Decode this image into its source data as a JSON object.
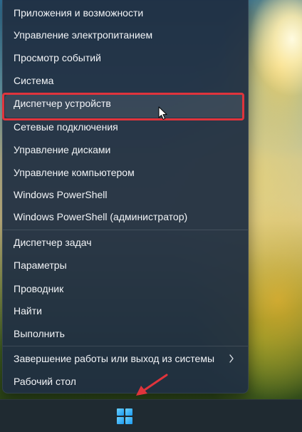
{
  "menu": {
    "items": [
      {
        "label": "Приложения и возможности"
      },
      {
        "label": "Управление электропитанием"
      },
      {
        "label": "Просмотр событий"
      },
      {
        "label": "Система"
      },
      {
        "label": "Диспетчер устройств"
      },
      {
        "label": "Сетевые подключения"
      },
      {
        "label": "Управление дисками"
      },
      {
        "label": "Управление компьютером"
      },
      {
        "label": "Windows PowerShell"
      },
      {
        "label": "Windows PowerShell (администратор)"
      },
      {
        "label": "Диспетчер задач"
      },
      {
        "label": "Параметры"
      },
      {
        "label": "Проводник"
      },
      {
        "label": "Найти"
      },
      {
        "label": "Выполнить"
      },
      {
        "label": "Завершение работы или выход из системы"
      },
      {
        "label": "Рабочий стол"
      }
    ],
    "highlighted_item": "Диспетчер устройств"
  },
  "colors": {
    "highlight_box": "#e0343c",
    "annotation_arrow": "#e0343c",
    "windows_logo": "#1d9bf0"
  },
  "icons": {
    "submenu": "chevron-right-icon",
    "start": "windows-logo-icon",
    "pointer": "mouse-cursor-icon"
  }
}
